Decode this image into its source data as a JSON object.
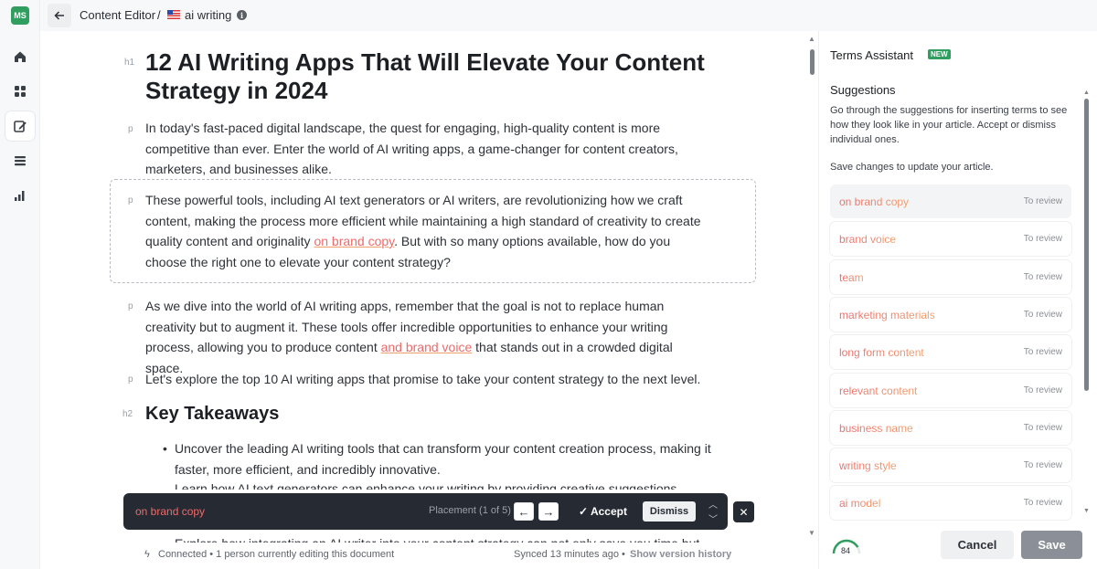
{
  "user": {
    "initials": "MS"
  },
  "breadcrumb": {
    "parent": "Content Editor",
    "separator": "/",
    "document": "ai writing"
  },
  "article": {
    "h1_tag": "h1",
    "title": "12 AI Writing Apps That Will Elevate Your Content Strategy in 2024",
    "p_tag": "p",
    "h2_tag": "h2",
    "para1": "In today's fast-paced digital landscape, the quest for engaging, high-quality content is more competitive than ever. Enter the world of AI writing apps, a game-changer for content creators, marketers, and businesses alike.",
    "para2_before": "These powerful tools, including AI text generators or AI writers, are revolutionizing how we craft content, making the process more efficient while maintaining a high standard of creativity to create quality content and originality ",
    "para2_highlight": "on brand copy",
    "para2_after": ". But with so many options available, how do you choose the right one to elevate your content strategy?",
    "para3_before": "As we dive into the world of AI writing apps, remember that the goal is not to replace human creativity but to augment it. These tools offer incredible opportunities to enhance your writing process, allowing you to produce content ",
    "para3_highlight": "and brand voice",
    "para3_after": " that stands out in a crowded digital space.",
    "para4": "Let's explore the top 10 AI writing apps that promise to take your content strategy to the next level.",
    "heading2": "Key Takeaways",
    "bullet1": "Uncover the leading AI writing tools that can transform your content creation process, making it faster, more efficient, and incredibly innovative.",
    "bullet2": "Learn how AI text generators can enhance your writing by providing creative suggestions",
    "bullet3": "Explore how integrating an AI writer into your content strategy can not only save you time but also"
  },
  "placement_bar": {
    "term": "on brand copy",
    "placement": "Placement (1 of 5)",
    "accept_label": "Accept",
    "dismiss_label": "Dismiss"
  },
  "footer": {
    "status": "Connected • 1 person currently editing this document",
    "synced": "Synced 13 minutes ago •",
    "version_link": "Show version history"
  },
  "panel": {
    "title": "Terms Assistant",
    "badge": "NEW",
    "suggestions_title": "Suggestions",
    "description": "Go through the suggestions for inserting terms to see how they look like in your article. Accept or dismiss individual ones.",
    "save_note": "Save changes to update your article.",
    "terms": [
      {
        "name": "on brand copy",
        "status": "To review"
      },
      {
        "name": "brand voice",
        "status": "To review"
      },
      {
        "name": "team",
        "status": "To review"
      },
      {
        "name": "marketing materials",
        "status": "To review"
      },
      {
        "name": "long form content",
        "status": "To review"
      },
      {
        "name": "relevant content",
        "status": "To review"
      },
      {
        "name": "business name",
        "status": "To review"
      },
      {
        "name": "writing style",
        "status": "To review"
      },
      {
        "name": "ai model",
        "status": "To review"
      }
    ],
    "score": "84",
    "score_fraction": 0.84,
    "cancel_label": "Cancel",
    "save_label": "Save"
  },
  "colors": {
    "accent_green": "#2f9e5f",
    "term_gradient_start": "#ec6b6b",
    "term_gradient_end": "#f0a070",
    "dark_bar": "#262a33"
  },
  "icons": [
    "home-icon",
    "dashboard-icon",
    "editor-icon",
    "list-icon",
    "chart-icon",
    "back-arrow-icon",
    "flag-us-icon",
    "info-icon",
    "check-icon",
    "close-icon",
    "lightning-icon"
  ]
}
